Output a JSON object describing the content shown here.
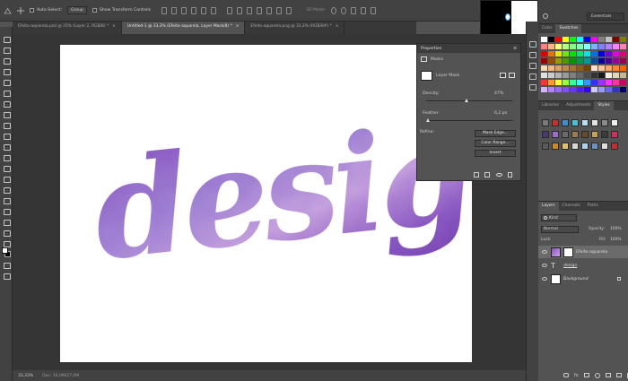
{
  "options_bar": {
    "auto_select_label": "Auto-Select:",
    "auto_select_value": "Group",
    "show_transform_label": "Show Transform Controls",
    "mode_3d_label": "3D Mode:"
  },
  "workspace": {
    "value": "Essentials"
  },
  "tabs": [
    {
      "label": "Efeito-aquarela.psd @ 25% (Layer 2, RGB/8) *",
      "active": false
    },
    {
      "label": "Untitled-1 @ 33,3% (Efeito-aquarela, Layer Mask/8) *",
      "active": true
    },
    {
      "label": "Efeito-aquarela.png @ 33,3% (RGB/8#) *",
      "active": false
    }
  ],
  "status": {
    "zoom": "33,33%",
    "doc": "Doc: 16,0M/27,0M"
  },
  "properties": {
    "title": "Properties",
    "masks_label": "Masks",
    "layer_mask_label": "Layer Mask",
    "density_label": "Density:",
    "density_value": "47%",
    "density_level": 0.47,
    "feather_label": "Feather:",
    "feather_value": "6,2 px",
    "feather_level": 0.03,
    "refine_label": "Refine:",
    "mask_edge_btn": "Mask Edge...",
    "color_range_btn": "Color Range...",
    "invert_btn": "Invert"
  },
  "color_panel": {
    "tabs": [
      "Color",
      "Swatches"
    ],
    "active": "Swatches"
  },
  "styles_panel": {
    "tabs": [
      "Libraries",
      "Adjustments",
      "Styles"
    ],
    "active": "Styles"
  },
  "layers_panel": {
    "tabs": [
      "Layers",
      "Channels",
      "Paths"
    ],
    "active": "Layers",
    "kind_label": "Kind",
    "blend_mode": "Normal",
    "opacity_label": "Opacity:",
    "opacity_value": "100%",
    "lock_label": "Lock:",
    "fill_label": "Fill:",
    "fill_value": "100%",
    "layers": [
      {
        "name": "Efeito-aquarela",
        "selected": true
      },
      {
        "name": "design",
        "selected": false
      },
      {
        "name": "Background",
        "selected": false
      }
    ]
  },
  "canvas": {
    "word": "design"
  },
  "colors": {
    "accent": "#3aa0ff",
    "ui_dark": "#424242",
    "panel": "#535353",
    "watercolor_light": "#c7a6dc",
    "watercolor_dark": "#6f3ba8"
  }
}
